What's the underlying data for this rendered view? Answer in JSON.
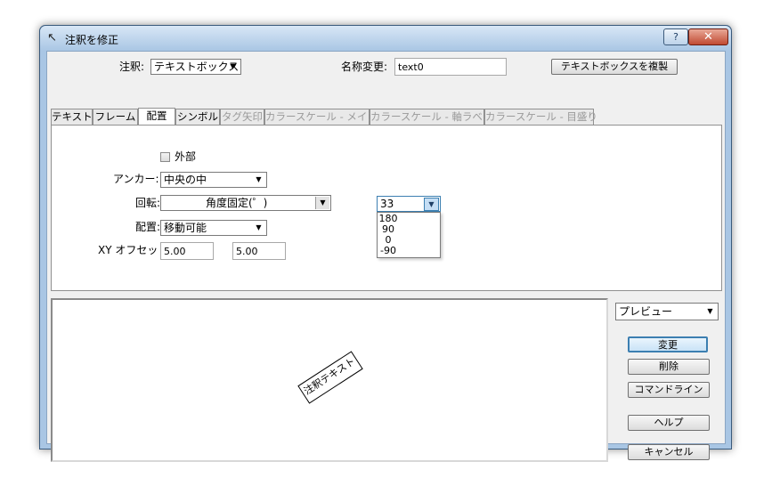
{
  "window": {
    "title": "注釈を修正",
    "help_label": "?",
    "close_label": "✕"
  },
  "top": {
    "annotation_label": "注釈:",
    "annotation_value": "テキストボックス",
    "rename_label": "名称変更:",
    "rename_value": "text0",
    "duplicate_button": "テキストボックスを複製"
  },
  "tabs": [
    {
      "label": "テキスト",
      "active": false,
      "enabled": true
    },
    {
      "label": "フレーム",
      "active": false,
      "enabled": true
    },
    {
      "label": "配置",
      "active": true,
      "enabled": true
    },
    {
      "label": "シンボル",
      "active": false,
      "enabled": true
    },
    {
      "label": "タグ矢印",
      "active": false,
      "enabled": false
    },
    {
      "label": "カラースケール - メイン",
      "active": false,
      "enabled": false
    },
    {
      "label": "カラースケール - 軸ラベル",
      "active": false,
      "enabled": false
    },
    {
      "label": "カラースケール - 目盛り",
      "active": false,
      "enabled": false
    }
  ],
  "placement": {
    "external_label": "外部",
    "external_checked": false,
    "anchor_label": "アンカー:",
    "anchor_value": "中央の中",
    "rotation_label": "回転:",
    "rotation_mode": "角度固定(゜)",
    "rotation_angle": "33",
    "rotation_options": [
      "180",
      "90",
      "0",
      "-90"
    ],
    "position_label": "配置:",
    "position_value": "移動可能",
    "xy_offset_label": "XY オフセット:",
    "x_offset": "5.00",
    "y_offset": "5.00"
  },
  "preview": {
    "mode_value": "プレビュー",
    "sample_text": "注釈テキスト",
    "rotation_deg": -33
  },
  "buttons": {
    "change": "変更",
    "delete": "削除",
    "command_line": "コマンドライン",
    "help": "ヘルプ",
    "cancel": "キャンセル"
  },
  "colors": {
    "frame": "#a9c6e4",
    "close_button": "#c04a32",
    "default_button_border": "#3c7fb1"
  }
}
